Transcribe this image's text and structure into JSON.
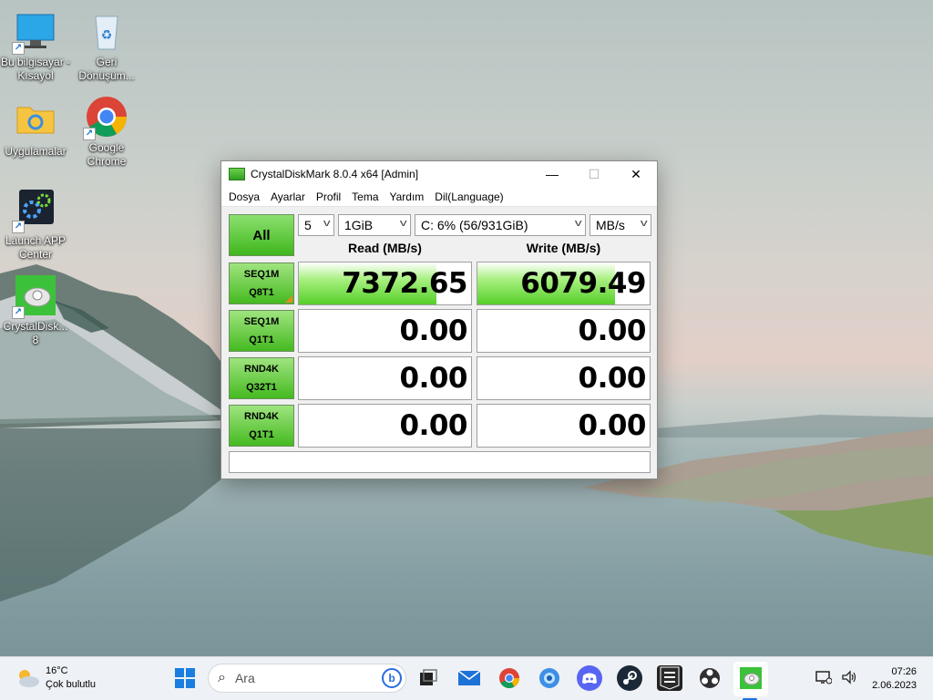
{
  "desktop": {
    "icons": [
      {
        "label": "Bu bilgisayar - Kısayol",
        "icon": "monitor-icon"
      },
      {
        "label": "Geri Dönüşüm...",
        "icon": "recycle-bin-icon"
      },
      {
        "label": "Uygulamalar",
        "icon": "folder-icon"
      },
      {
        "label": "Google Chrome",
        "icon": "chrome-icon"
      },
      {
        "label": "Launch APP Center",
        "icon": "gears-icon"
      },
      {
        "label": "CrystalDisk... 8",
        "icon": "crystaldiskmark-icon"
      }
    ]
  },
  "window": {
    "title": "CrystalDiskMark 8.0.4 x64 [Admin]",
    "controls": {
      "minimize": "—",
      "maximize": "☐",
      "close": "✕"
    },
    "menu": [
      "Dosya",
      "Ayarlar",
      "Profil",
      "Tema",
      "Yardım",
      "Dil(Language)"
    ],
    "all_button": "All",
    "selects": {
      "count": "5",
      "size": "1GiB",
      "drive": "C: 6% (56/931GiB)",
      "unit": "MB/s"
    },
    "headers": {
      "read": "Read (MB/s)",
      "write": "Write (MB/s)"
    },
    "rows": [
      {
        "line1": "SEQ1M",
        "line2": "Q8T1",
        "read": "7372.65",
        "write": "6079.49",
        "read_fill": 0.8,
        "write_fill": 0.8
      },
      {
        "line1": "SEQ1M",
        "line2": "Q1T1",
        "read": "0.00",
        "write": "0.00",
        "read_fill": 0,
        "write_fill": 0
      },
      {
        "line1": "RND4K",
        "line2": "Q32T1",
        "read": "0.00",
        "write": "0.00",
        "read_fill": 0,
        "write_fill": 0
      },
      {
        "line1": "RND4K",
        "line2": "Q1T1",
        "read": "0.00",
        "write": "0.00",
        "read_fill": 0,
        "write_fill": 0
      }
    ],
    "comment": ""
  },
  "taskbar": {
    "weather": {
      "temp": "16°C",
      "desc": "Çok bulutlu"
    },
    "search_placeholder": "Ara",
    "apps": [
      "windows-start-icon",
      "task-view-icon",
      "mail-icon",
      "chrome-icon",
      "browser-icon",
      "discord-icon",
      "steam-icon",
      "epic-games-icon",
      "obs-icon",
      "crystaldiskmark-icon"
    ],
    "clock": {
      "time": "07:26",
      "date": "2.06.2023"
    }
  }
}
